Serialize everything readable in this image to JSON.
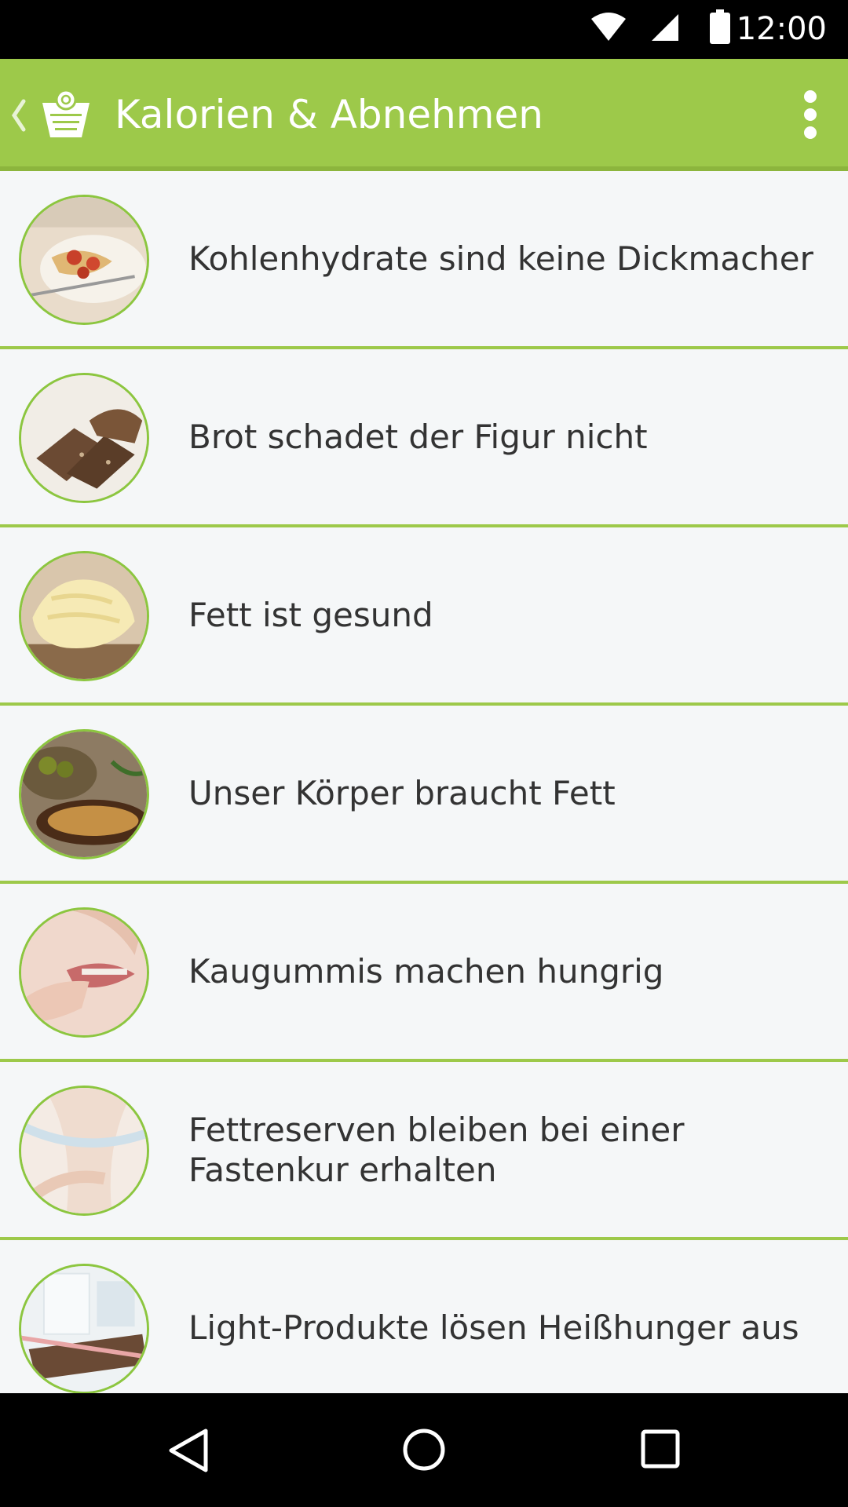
{
  "status_bar": {
    "time": "12:00",
    "icons": [
      "wifi-icon",
      "cell-signal-icon",
      "battery-icon"
    ]
  },
  "app_bar": {
    "title": "Kalorien & Abnehmen",
    "icons": [
      "back-chevron-icon",
      "scale-logo-icon",
      "overflow-menu-icon"
    ],
    "background_color": "#9dc94a"
  },
  "list": {
    "accent_color": "#9dc94a",
    "items": [
      {
        "label": "Kohlenhydrate sind keine Dickmacher",
        "image": "pasta-photo"
      },
      {
        "label": "Brot schadet der Figur nicht",
        "image": "bread-photo"
      },
      {
        "label": "Fett ist gesund",
        "image": "butter-photo"
      },
      {
        "label": "Unser Körper braucht Fett",
        "image": "olive-oil-photo"
      },
      {
        "label": "Kaugummis machen hungrig",
        "image": "chewing-gum-photo"
      },
      {
        "label": "Fettreserven bleiben bei einer Fastenkur erhalten",
        "image": "measuring-tape-photo"
      },
      {
        "label": "Light-Produkte lösen Heißhunger aus",
        "image": "light-products-photo"
      }
    ]
  },
  "nav_bar": {
    "icons": [
      "back-triangle-icon",
      "home-circle-icon",
      "recents-square-icon"
    ]
  }
}
